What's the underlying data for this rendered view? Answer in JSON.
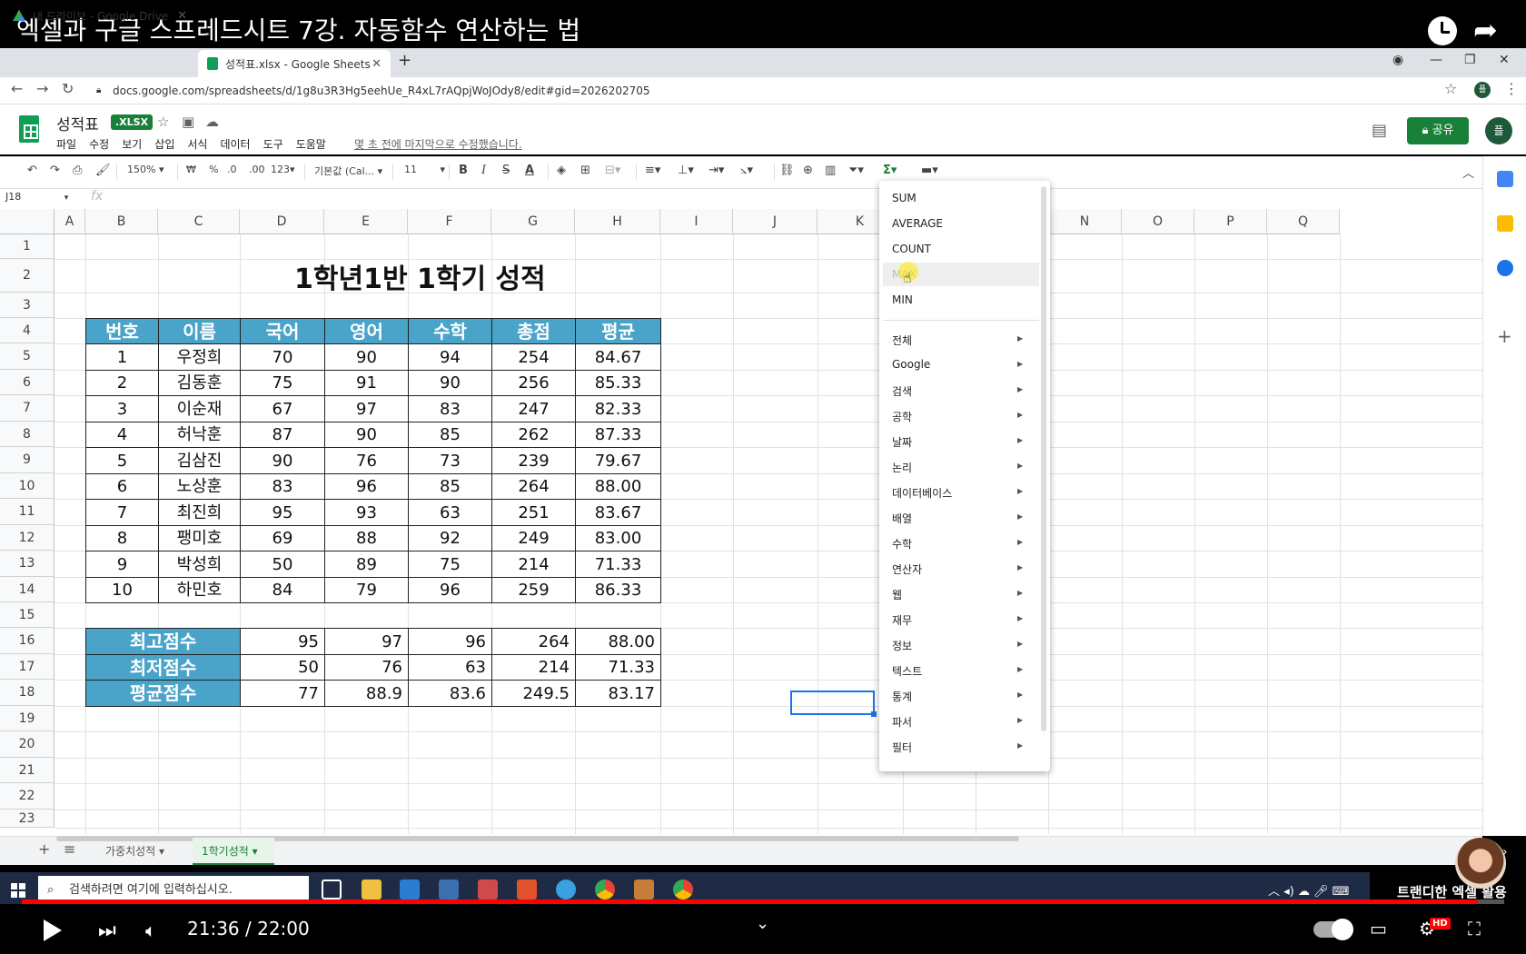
{
  "video": {
    "title": "엑셀과 구글 스프레드시트 7강. 자동함수 연산하는 법",
    "time_current": "21:36",
    "time_sep": " / ",
    "time_total": "22:00",
    "progress": 0.982,
    "hd_badge": "HD",
    "channel": "트랜디한 엑셀 활용"
  },
  "browser": {
    "tabs": [
      {
        "label": "내 드라이브 - Google Drive",
        "active": false
      },
      {
        "label": "성적표.xlsx - Google Sheets",
        "active": true
      }
    ],
    "url": "docs.google.com/spreadsheets/d/1g8u3R3Hg5eehUe_R4xL7rAQpjWoJOdy8/edit#gid=2026202705",
    "profile_initial": "플"
  },
  "sheets": {
    "doc_title": "성적표",
    "badge": ".XLSX",
    "menu": [
      "파일",
      "수정",
      "보기",
      "삽입",
      "서식",
      "데이터",
      "도구",
      "도움말"
    ],
    "last_edit": "몇 초 전에 마지막으로 수정했습니다.",
    "share_label": "공유",
    "avatar_initial": "플",
    "zoom": "150%",
    "font": "기본값 (Cal...",
    "font_size": "11",
    "currency": "₩",
    "percent": "%",
    "dec_dec": ".0",
    "dec_inc": ".00",
    "format_more": "123",
    "name_box": "J18",
    "fx": "fx"
  },
  "grid": {
    "columns": [
      "A",
      "B",
      "C",
      "D",
      "E",
      "F",
      "G",
      "H",
      "I",
      "J",
      "K",
      "L",
      "M",
      "N",
      "O",
      "P",
      "Q"
    ],
    "rows": [
      "1",
      "2",
      "3",
      "4",
      "5",
      "6",
      "7",
      "8",
      "9",
      "10",
      "11",
      "12",
      "13",
      "14",
      "15",
      "16",
      "17",
      "18",
      "19",
      "20",
      "21",
      "22",
      "23"
    ],
    "sheet_title": "1학년1반 1학기 성적",
    "headers": [
      "번호",
      "이름",
      "국어",
      "영어",
      "수학",
      "총점",
      "평균"
    ],
    "students": [
      [
        "1",
        "우정희",
        "70",
        "90",
        "94",
        "254",
        "84.67"
      ],
      [
        "2",
        "김동훈",
        "75",
        "91",
        "90",
        "256",
        "85.33"
      ],
      [
        "3",
        "이순재",
        "67",
        "97",
        "83",
        "247",
        "82.33"
      ],
      [
        "4",
        "허낙훈",
        "87",
        "90",
        "85",
        "262",
        "87.33"
      ],
      [
        "5",
        "김삼진",
        "90",
        "76",
        "73",
        "239",
        "79.67"
      ],
      [
        "6",
        "노상훈",
        "83",
        "96",
        "85",
        "264",
        "88.00"
      ],
      [
        "7",
        "최진희",
        "95",
        "93",
        "63",
        "251",
        "83.67"
      ],
      [
        "8",
        "팽미호",
        "69",
        "88",
        "92",
        "249",
        "83.00"
      ],
      [
        "9",
        "박성희",
        "50",
        "89",
        "75",
        "214",
        "71.33"
      ],
      [
        "10",
        "하민호",
        "84",
        "79",
        "96",
        "259",
        "86.33"
      ]
    ],
    "summary": [
      [
        "최고점수",
        "95",
        "97",
        "96",
        "264",
        "88.00"
      ],
      [
        "최저점수",
        "50",
        "76",
        "63",
        "214",
        "71.33"
      ],
      [
        "평균점수",
        "77",
        "88.9",
        "83.6",
        "249.5",
        "83.17"
      ]
    ]
  },
  "function_menu": {
    "quick": [
      "SUM",
      "AVERAGE",
      "COUNT",
      "MAX",
      "MIN"
    ],
    "categories": [
      "전체",
      "Google",
      "검색",
      "공학",
      "날짜",
      "논리",
      "데이터베이스",
      "배열",
      "수학",
      "연산자",
      "웹",
      "재무",
      "정보",
      "텍스트",
      "통계",
      "파서",
      "필터"
    ],
    "hovered": "MAX"
  },
  "sheet_tabs": [
    "가중치성적",
    "1학기성적"
  ],
  "taskbar": {
    "search_placeholder": "검색하려면 여기에 입력하십시오."
  },
  "colors": {
    "header_blue": "#4aa3c8",
    "sheets_green": "#188038",
    "selection_blue": "#1a73e8",
    "yt_red": "#ff0000"
  }
}
